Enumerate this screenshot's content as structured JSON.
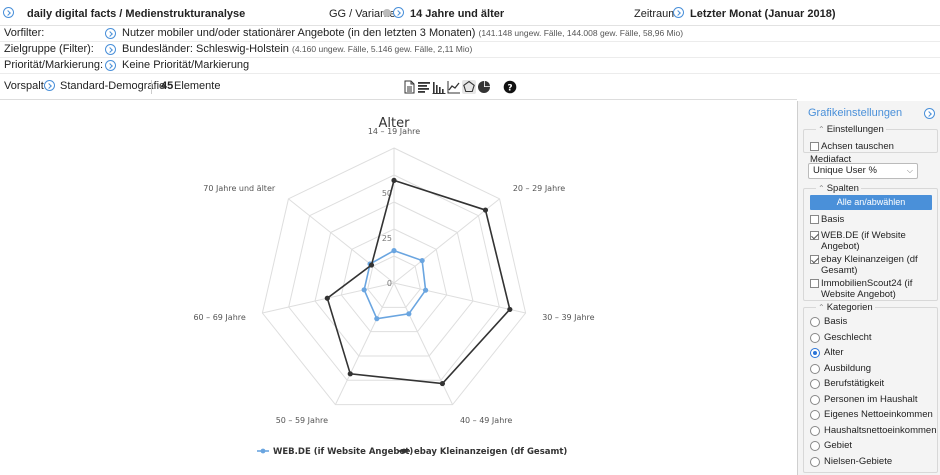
{
  "topbar": {
    "title": "daily digital facts / Medienstrukturanalyse",
    "gg_label": "GG / Variante:",
    "gg_value": "14 Jahre und älter",
    "zeitraum_label": "Zeitraum:",
    "zeitraum_value": "Letzter Monat (Januar 2018)"
  },
  "filters": {
    "vorfilter": {
      "label": "Vorfilter:",
      "value": "Nutzer mobiler und/oder stationärer Angebote (in den letzten 3 Monaten)",
      "note": "(141.148 ungew. Fälle, 144.008 gew. Fälle, 58,96 Mio)"
    },
    "zielgruppe": {
      "label": "Zielgruppe (Filter):",
      "value": "Bundesländer: Schleswig-Holstein",
      "note": "(4.160 ungew. Fälle, 5.146 gew. Fälle, 2,11 Mio)"
    },
    "prioritaet": {
      "label": "Priorität/Markierung:",
      "value": "Keine Priorität/Markierung"
    }
  },
  "vorspalte": {
    "label": "Vorspalte:",
    "value": "Standard-Demografie",
    "count": "45",
    "count_label": "Elemente"
  },
  "toolbar_icons": [
    "document-icon",
    "text-align-icon",
    "bar-chart-icon",
    "line-chart-icon",
    "radar-chart-icon",
    "pie-chart-icon",
    "help-icon"
  ],
  "chart_data": {
    "type": "radar",
    "title": "Alter",
    "categories": [
      "14 – 19 Jahre",
      "20 – 29 Jahre",
      "30 – 39 Jahre",
      "40 – 49 Jahre",
      "50 – 59 Jahre",
      "60 – 69 Jahre",
      "70 Jahre und älter"
    ],
    "ticks": [
      0,
      25,
      50
    ],
    "rmax": 75,
    "series": [
      {
        "name": "WEB.DE (if Website Angebot)",
        "color": "#6aa5e0",
        "values": [
          18,
          20,
          18,
          19,
          22,
          17,
          17
        ]
      },
      {
        "name": "ebay Kleinanzeigen (df Gesamt)",
        "color": "#333333",
        "values": [
          57,
          65,
          66,
          62,
          56,
          38,
          16
        ]
      }
    ],
    "legend_position": "bottom"
  },
  "panel": {
    "title": "Grafikeinstellungen",
    "einstellungen": {
      "legend": "Einstellungen",
      "achsen_tauschen": "Achsen tauschen"
    },
    "mediafact": {
      "label": "Mediafact",
      "value": "Unique User %"
    },
    "spalten": {
      "legend": "Spalten",
      "toggle_all": "Alle an/abwählen",
      "items": [
        {
          "label": "Basis",
          "checked": false
        },
        {
          "label": "WEB.DE (if Website Angebot)",
          "checked": true
        },
        {
          "label": "ebay Kleinanzeigen (df Gesamt)",
          "checked": true
        },
        {
          "label": "ImmobilienScout24 (if Website Angebot)",
          "checked": false
        }
      ]
    },
    "kategorien": {
      "legend": "Kategorien",
      "selected": "Alter",
      "items": [
        "Basis",
        "Geschlecht",
        "Alter",
        "Ausbildung",
        "Berufstätigkeit",
        "Personen im Haushalt",
        "Eigenes Nettoeinkommen",
        "Haushaltsnettoeinkommen",
        "Gebiet",
        "Nielsen-Gebiete"
      ]
    }
  }
}
